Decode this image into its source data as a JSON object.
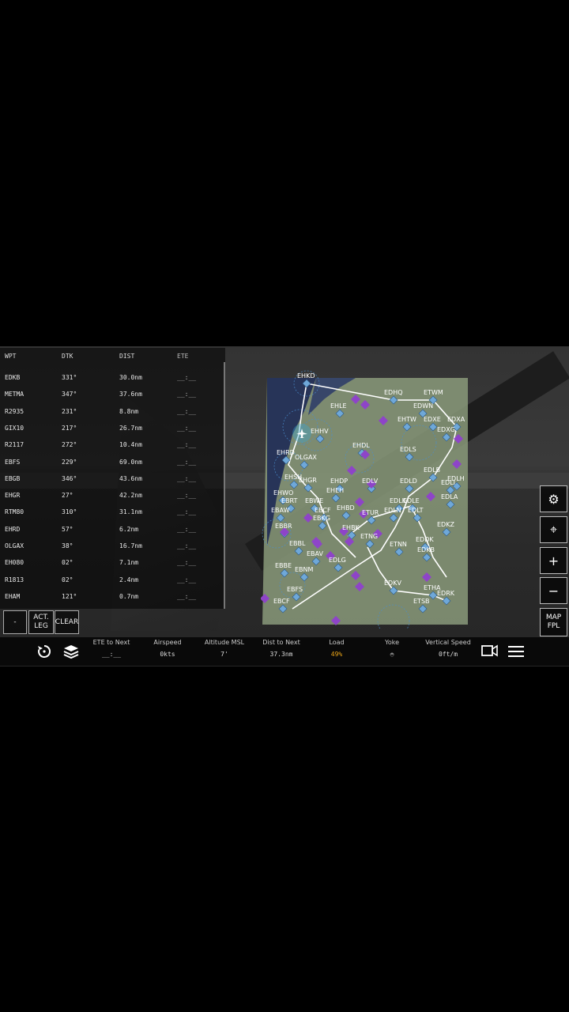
{
  "fpl": {
    "headers": {
      "wpt": "WPT",
      "dtk": "DTK",
      "dist": "DIST",
      "ete": "ETE"
    },
    "rows": [
      {
        "wpt": "EDKB",
        "dtk": "331°",
        "dist": "30.0nm",
        "ete": "__:__"
      },
      {
        "wpt": "METMA",
        "dtk": "347°",
        "dist": "37.6nm",
        "ete": "__:__"
      },
      {
        "wpt": "R2935",
        "dtk": "231°",
        "dist": "8.8nm",
        "ete": "__:__"
      },
      {
        "wpt": "GIX10",
        "dtk": "217°",
        "dist": "26.7nm",
        "ete": "__:__"
      },
      {
        "wpt": "R2117",
        "dtk": "272°",
        "dist": "10.4nm",
        "ete": "__:__"
      },
      {
        "wpt": "EBFS",
        "dtk": "229°",
        "dist": "69.0nm",
        "ete": "__:__"
      },
      {
        "wpt": "EBGB",
        "dtk": "346°",
        "dist": "43.6nm",
        "ete": "__:__"
      },
      {
        "wpt": "EHGR",
        "dtk": "27°",
        "dist": "42.2nm",
        "ete": "__:__"
      },
      {
        "wpt": "RTM80",
        "dtk": "310°",
        "dist": "31.1nm",
        "ete": "__:__"
      },
      {
        "wpt": "EHRD",
        "dtk": "57°",
        "dist": "6.2nm",
        "ete": "__:__"
      },
      {
        "wpt": "OLGAX",
        "dtk": "38°",
        "dist": "16.7nm",
        "ete": "__:__"
      },
      {
        "wpt": "EH080",
        "dtk": "02°",
        "dist": "7.1nm",
        "ete": "__:__"
      },
      {
        "wpt": "R1813",
        "dtk": "02°",
        "dist": "2.4nm",
        "ete": "__:__"
      },
      {
        "wpt": "EHAM",
        "dtk": "121°",
        "dist": "0.7nm",
        "ete": "__:__"
      }
    ],
    "buttons": {
      "minus": "-",
      "act_leg_1": "ACT.",
      "act_leg_2": "LEG",
      "clear": "CLEAR"
    }
  },
  "bottom_bar": {
    "etl_label": "ETE to Next",
    "etl_value": "__:__",
    "airspeed_label": "Airspeed",
    "airspeed_value": "0kts",
    "altitude_label": "Altitude MSL",
    "altitude_value": "7'",
    "dist_label": "Dist to Next",
    "dist_value": "37.3nm",
    "load_label": "Load",
    "load_value": "49%",
    "yoke_label": "Yoke",
    "vs_label": "Vertical Speed",
    "vs_value": "0ft/m"
  },
  "right_buttons": {
    "map_fpl_1": "MAP",
    "map_fpl_2": "FPL"
  },
  "map_labels": [
    "EHKD",
    "EDHQ",
    "ETWM",
    "EHLE",
    "EDWN",
    "EDXA",
    "EHTW",
    "EDXE",
    "EDXG",
    "EHHV",
    "EHDL",
    "EDLS",
    "EHRD",
    "OLGAX",
    "EDLB",
    "EDLH",
    "EHGR",
    "EHSH",
    "EHDP",
    "EDLV",
    "EDLD",
    "EDLI",
    "EHWO",
    "EBRT",
    "EHEH",
    "EBWE",
    "EDLA",
    "EDLK",
    "EDLE",
    "EBAW",
    "EHBD",
    "EBKG",
    "EDLN",
    "EDLT",
    "ETUR",
    "EDKZ",
    "EBCF",
    "EBBR",
    "EHBK",
    "ETNG",
    "ETNN",
    "EDDK",
    "EDKB",
    "EBBL",
    "EBAV",
    "EDLG",
    "EBBE",
    "EBNM",
    "EDKV",
    "ETHA",
    "EDRK",
    "EBFS",
    "ETSB",
    "EBCF"
  ],
  "colors": {
    "route": "#ffffff",
    "airport": "#6fa8d8",
    "vor": "#8e44c8",
    "map_land": "#8a9a7a",
    "map_sea": "#1e2a55",
    "load": "#e8a317"
  },
  "icons": {
    "settings": "gear-icon",
    "recenter": "crosshair-icon",
    "zoom_in": "plus-icon",
    "zoom_out": "minus-icon",
    "history": "restart-icon",
    "layers": "layers-icon",
    "camera": "camera-icon",
    "menu": "menu-icon",
    "aircraft": "aircraft-icon"
  }
}
